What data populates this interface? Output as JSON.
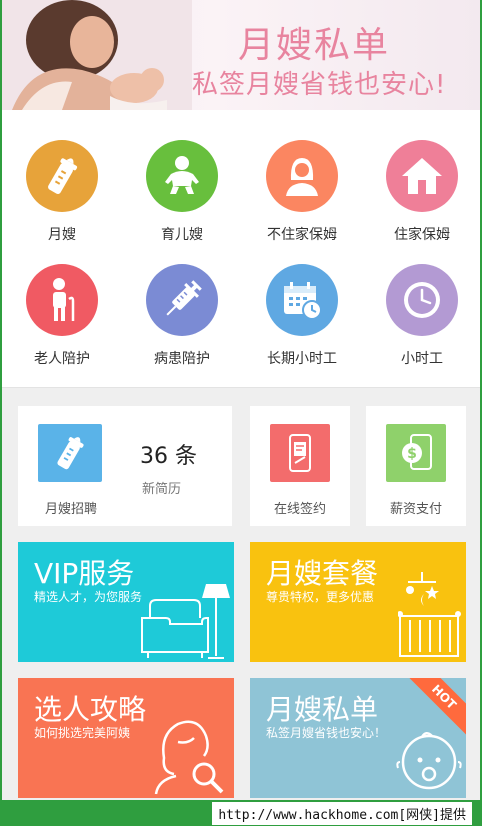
{
  "banner": {
    "title": "月嫂私单",
    "subtitle": "私签月嫂省钱也安心!"
  },
  "categories": [
    {
      "label": "月嫂",
      "icon": "baby-bottle-icon",
      "color": "#e7a33a"
    },
    {
      "label": "育儿嫂",
      "icon": "baby-icon",
      "color": "#68bf3d"
    },
    {
      "label": "不住家保姆",
      "icon": "woman-icon",
      "color": "#fb8661"
    },
    {
      "label": "住家保姆",
      "icon": "home-icon",
      "color": "#ef7f98"
    },
    {
      "label": "老人陪护",
      "icon": "elder-icon",
      "color": "#f05a63"
    },
    {
      "label": "病患陪护",
      "icon": "syringe-icon",
      "color": "#7b8bd4"
    },
    {
      "label": "长期小时工",
      "icon": "calendar-icon",
      "color": "#5fa8e2"
    },
    {
      "label": "小时工",
      "icon": "clock-icon",
      "color": "#b39ad3"
    }
  ],
  "cards": {
    "recruit": {
      "label": "月嫂招聘",
      "count": "36 条",
      "count_sub": "新简历"
    },
    "sign": {
      "label": "在线签约"
    },
    "pay": {
      "label": "薪资支付",
      "symbol": "$"
    }
  },
  "tiles": {
    "vip": {
      "title": "VIP服务",
      "subtitle": "精选人才，为您服务",
      "color": "#1ecad8"
    },
    "package": {
      "title": "月嫂套餐",
      "subtitle": "尊贵特权，更多优惠",
      "color": "#f9c20f"
    },
    "guide": {
      "title": "选人攻略",
      "subtitle": "如何挑选完美阿姨",
      "color": "#f97453"
    },
    "private": {
      "title": "月嫂私单",
      "subtitle": "私签月嫂省钱也安心！",
      "color": "#8fc4d6",
      "badge": "HOT"
    }
  },
  "footer": {
    "text": "http://www.hackhome.com[网侠]提供"
  }
}
